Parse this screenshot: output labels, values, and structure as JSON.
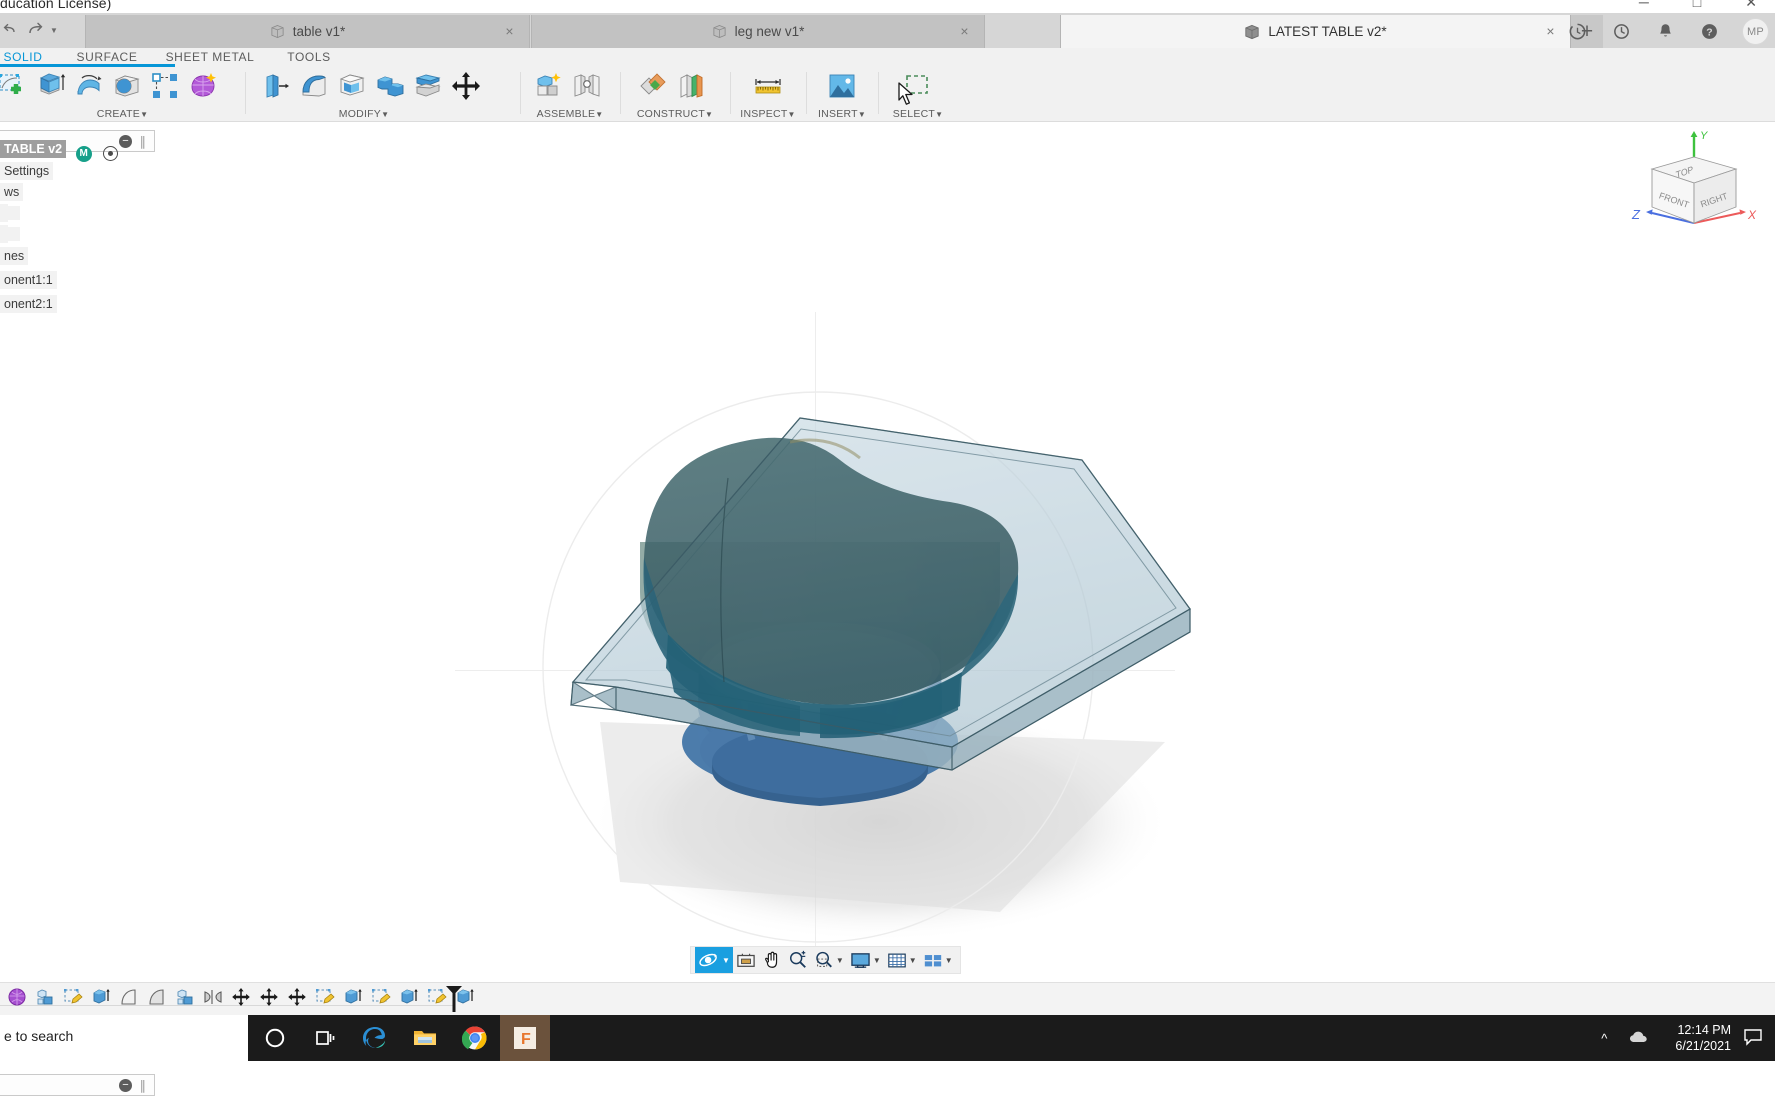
{
  "window": {
    "title_fragment": "ducation License)",
    "controls": [
      "minimize",
      "maximize",
      "close"
    ]
  },
  "tabbar": {
    "quick_access": [
      "undo-icon",
      "redo-icon",
      "redo-dropdown-icon"
    ],
    "tabs": [
      {
        "label": "table v1*",
        "icon": "component-cube-icon",
        "active": false,
        "close": "×"
      },
      {
        "label": "leg new v1*",
        "icon": "component-cube-icon",
        "active": false,
        "close": "×"
      },
      {
        "label": "LATEST TABLE v2*",
        "icon": "component-cube-icon",
        "active": true,
        "close": "×"
      }
    ],
    "new_tab_label": "+",
    "right_icons": [
      "job-status-icon",
      "recent-activity-icon",
      "notifications-bell-icon",
      "help-question-icon"
    ],
    "avatar_initials": "MP"
  },
  "ribbon_tabs": [
    {
      "label": "SOLID",
      "active": true
    },
    {
      "label": "SURFACE",
      "active": false
    },
    {
      "label": "SHEET METAL",
      "active": false
    },
    {
      "label": "TOOLS",
      "active": false
    }
  ],
  "ribbon_panels": [
    {
      "name": "CREATE",
      "label": "CREATE",
      "dropdown": true,
      "tools": [
        "new-sketch-icon",
        "extrude-icon",
        "revolve-icon",
        "hole-icon",
        "pattern-icon",
        "form-icon"
      ]
    },
    {
      "name": "MODIFY",
      "label": "MODIFY",
      "dropdown": true,
      "tools": [
        "press-pull-icon",
        "fillet-icon",
        "shell-icon",
        "combine-icon",
        "split-face-icon",
        "move-copy-icon"
      ]
    },
    {
      "name": "ASSEMBLE",
      "label": "ASSEMBLE",
      "dropdown": true,
      "tools": [
        "new-component-icon",
        "joint-icon"
      ]
    },
    {
      "name": "CONSTRUCT",
      "label": "CONSTRUCT",
      "dropdown": true,
      "tools": [
        "offset-plane-icon",
        "plane-through-icon"
      ]
    },
    {
      "name": "INSPECT",
      "label": "INSPECT",
      "dropdown": true,
      "tools": [
        "measure-icon"
      ]
    },
    {
      "name": "INSERT",
      "label": "INSERT",
      "dropdown": true,
      "tools": [
        "insert-image-icon"
      ]
    },
    {
      "name": "SELECT",
      "label": "SELECT",
      "dropdown": true,
      "tools": [
        "select-window-icon"
      ]
    }
  ],
  "browser": {
    "search_placeholder": "",
    "search_value": "",
    "collapse_icon": "collapse-minus-icon",
    "rows": [
      {
        "label": "TABLE v2",
        "selected": true,
        "badges": [
          "material-m-badge",
          "visibility-eye-icon"
        ],
        "indent": 0
      },
      {
        "label": "Settings",
        "selected": false,
        "badges": [],
        "indent": 0
      },
      {
        "label": "ws",
        "selected": false,
        "badges": [],
        "indent": 0
      },
      {
        "label": "",
        "selected": false,
        "badges": [],
        "indent": 0
      },
      {
        "label": "",
        "selected": false,
        "badges": [],
        "indent": 0
      },
      {
        "label": "nes",
        "selected": false,
        "badges": [],
        "indent": 0
      },
      {
        "label": "onent1:1",
        "selected": false,
        "badges": [],
        "indent": 0
      },
      {
        "label": "onent2:1",
        "selected": false,
        "badges": [],
        "indent": 0
      }
    ]
  },
  "canvas": {
    "model_name": "table-assembly-model",
    "colors": {
      "glass_top": "#b9ccd6",
      "glass_edge": "#5d7a85",
      "bowl_inner": "#3d5d63",
      "bowl_outer": "#2e6b80",
      "base_blue": "#4a7fb0",
      "shadow": "#d8d8d8",
      "accent": "#0696d7"
    },
    "navcube": {
      "faces": [
        "TOP",
        "FRONT",
        "RIGHT"
      ],
      "axes": [
        {
          "label": "Y",
          "color": "#3ec23e"
        },
        {
          "label": "X",
          "color": "#ec5a5a"
        },
        {
          "label": "Z",
          "color": "#4a6fe0"
        }
      ]
    }
  },
  "viewbar": {
    "buttons": [
      {
        "name": "orbit-icon",
        "active": true,
        "dropdown": true
      },
      {
        "name": "display-settings-icon",
        "active": false,
        "dropdown": false
      },
      {
        "name": "pan-hand-icon",
        "active": false,
        "dropdown": false
      },
      {
        "name": "zoom-icon",
        "active": false,
        "dropdown": false
      },
      {
        "name": "fit-zoom-window-icon",
        "active": false,
        "dropdown": true
      },
      {
        "name": "display-mode-icon",
        "active": false,
        "dropdown": true
      },
      {
        "name": "grid-snaps-icon",
        "active": false,
        "dropdown": true
      },
      {
        "name": "viewports-icon",
        "active": false,
        "dropdown": true
      }
    ]
  },
  "timeline": {
    "features": [
      "form-feature-icon",
      "component-feature-icon",
      "sketch-feature-icon",
      "extrude-feature-icon",
      "loft-feature-icon",
      "loft-feature-icon",
      "component-feature-icon",
      "mirror-feature-icon",
      "move-feature-icon",
      "move-feature-icon",
      "move-feature-icon",
      "sketch-feature-icon",
      "extrude-feature-icon",
      "sketch-feature-icon",
      "extrude-feature-icon",
      "sketch-feature-icon",
      "extrude-feature-icon",
      "sketch-feature-icon",
      "extrude-feature-icon"
    ],
    "marker": "timeline-end-marker"
  },
  "taskbar": {
    "search_text": "e to search",
    "apps": [
      {
        "name": "cortana-icon",
        "active": false
      },
      {
        "name": "task-view-icon",
        "active": false
      },
      {
        "name": "microsoft-edge-icon",
        "active": false
      },
      {
        "name": "file-explorer-icon",
        "active": false
      },
      {
        "name": "google-chrome-icon",
        "active": false
      },
      {
        "name": "fusion360-icon",
        "active": true
      }
    ],
    "tray": {
      "chevron": "show-hidden-icons-chevron",
      "cloud": "onedrive-cloud-icon",
      "time": "12:14 PM",
      "date": "6/21/2021",
      "action_center": "action-center-icon"
    }
  }
}
